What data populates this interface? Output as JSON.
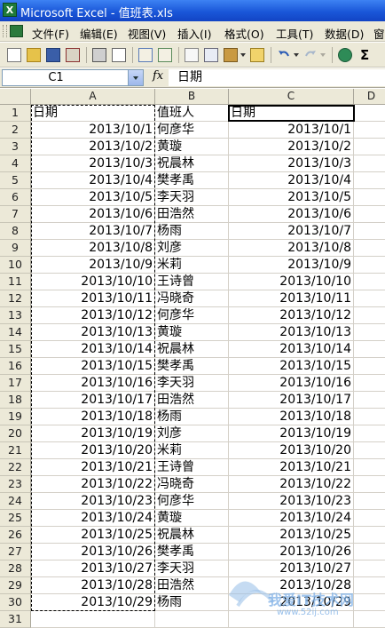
{
  "window": {
    "title": "Microsoft Excel - 值班表.xls"
  },
  "menu": [
    {
      "label": "文件(F)"
    },
    {
      "label": "编辑(E)"
    },
    {
      "label": "视图(V)"
    },
    {
      "label": "插入(I)"
    },
    {
      "label": "格式(O)"
    },
    {
      "label": "工具(T)"
    },
    {
      "label": "数据(D)"
    },
    {
      "label": "窗"
    }
  ],
  "formula_bar": {
    "name_box": "C1",
    "fx": "fx",
    "content": "日期"
  },
  "columns": [
    "A",
    "B",
    "C",
    "D"
  ],
  "rows": [
    {
      "n": "1",
      "a": "日期",
      "b": "值班人",
      "c": "日期"
    },
    {
      "n": "2",
      "a": "2013/10/1",
      "b": "何彦华",
      "c": "2013/10/1"
    },
    {
      "n": "3",
      "a": "2013/10/2",
      "b": "黄璇",
      "c": "2013/10/2"
    },
    {
      "n": "4",
      "a": "2013/10/3",
      "b": "祝晨林",
      "c": "2013/10/3"
    },
    {
      "n": "5",
      "a": "2013/10/4",
      "b": "樊孝禹",
      "c": "2013/10/4"
    },
    {
      "n": "6",
      "a": "2013/10/5",
      "b": "李天羽",
      "c": "2013/10/5"
    },
    {
      "n": "7",
      "a": "2013/10/6",
      "b": "田浩然",
      "c": "2013/10/6"
    },
    {
      "n": "8",
      "a": "2013/10/7",
      "b": "杨雨",
      "c": "2013/10/7"
    },
    {
      "n": "9",
      "a": "2013/10/8",
      "b": "刘彦",
      "c": "2013/10/8"
    },
    {
      "n": "10",
      "a": "2013/10/9",
      "b": "米莉",
      "c": "2013/10/9"
    },
    {
      "n": "11",
      "a": "2013/10/10",
      "b": "王诗曾",
      "c": "2013/10/10"
    },
    {
      "n": "12",
      "a": "2013/10/11",
      "b": "冯晓奇",
      "c": "2013/10/11"
    },
    {
      "n": "13",
      "a": "2013/10/12",
      "b": "何彦华",
      "c": "2013/10/12"
    },
    {
      "n": "14",
      "a": "2013/10/13",
      "b": "黄璇",
      "c": "2013/10/13"
    },
    {
      "n": "15",
      "a": "2013/10/14",
      "b": "祝晨林",
      "c": "2013/10/14"
    },
    {
      "n": "16",
      "a": "2013/10/15",
      "b": "樊孝禹",
      "c": "2013/10/15"
    },
    {
      "n": "17",
      "a": "2013/10/16",
      "b": "李天羽",
      "c": "2013/10/16"
    },
    {
      "n": "18",
      "a": "2013/10/17",
      "b": "田浩然",
      "c": "2013/10/17"
    },
    {
      "n": "19",
      "a": "2013/10/18",
      "b": "杨雨",
      "c": "2013/10/18"
    },
    {
      "n": "20",
      "a": "2013/10/19",
      "b": "刘彦",
      "c": "2013/10/19"
    },
    {
      "n": "21",
      "a": "2013/10/20",
      "b": "米莉",
      "c": "2013/10/20"
    },
    {
      "n": "22",
      "a": "2013/10/21",
      "b": "王诗曾",
      "c": "2013/10/21"
    },
    {
      "n": "23",
      "a": "2013/10/22",
      "b": "冯晓奇",
      "c": "2013/10/22"
    },
    {
      "n": "24",
      "a": "2013/10/23",
      "b": "何彦华",
      "c": "2013/10/23"
    },
    {
      "n": "25",
      "a": "2013/10/24",
      "b": "黄璇",
      "c": "2013/10/24"
    },
    {
      "n": "26",
      "a": "2013/10/25",
      "b": "祝晨林",
      "c": "2013/10/25"
    },
    {
      "n": "27",
      "a": "2013/10/26",
      "b": "樊孝禹",
      "c": "2013/10/26"
    },
    {
      "n": "28",
      "a": "2013/10/27",
      "b": "李天羽",
      "c": "2013/10/27"
    },
    {
      "n": "29",
      "a": "2013/10/28",
      "b": "田浩然",
      "c": "2013/10/28"
    },
    {
      "n": "30",
      "a": "2013/10/29",
      "b": "杨雨",
      "c": "2013/10/29"
    },
    {
      "n": "31",
      "a": "",
      "b": "",
      "c": ""
    }
  ],
  "watermark": {
    "text": "我爱IT技术网",
    "url": "www.52ij.com"
  },
  "colors": {
    "titlebar": "#1a57d9",
    "chrome": "#ece9d8",
    "grid": "#d4d0c8",
    "excel_green": "#1f7a3a"
  }
}
